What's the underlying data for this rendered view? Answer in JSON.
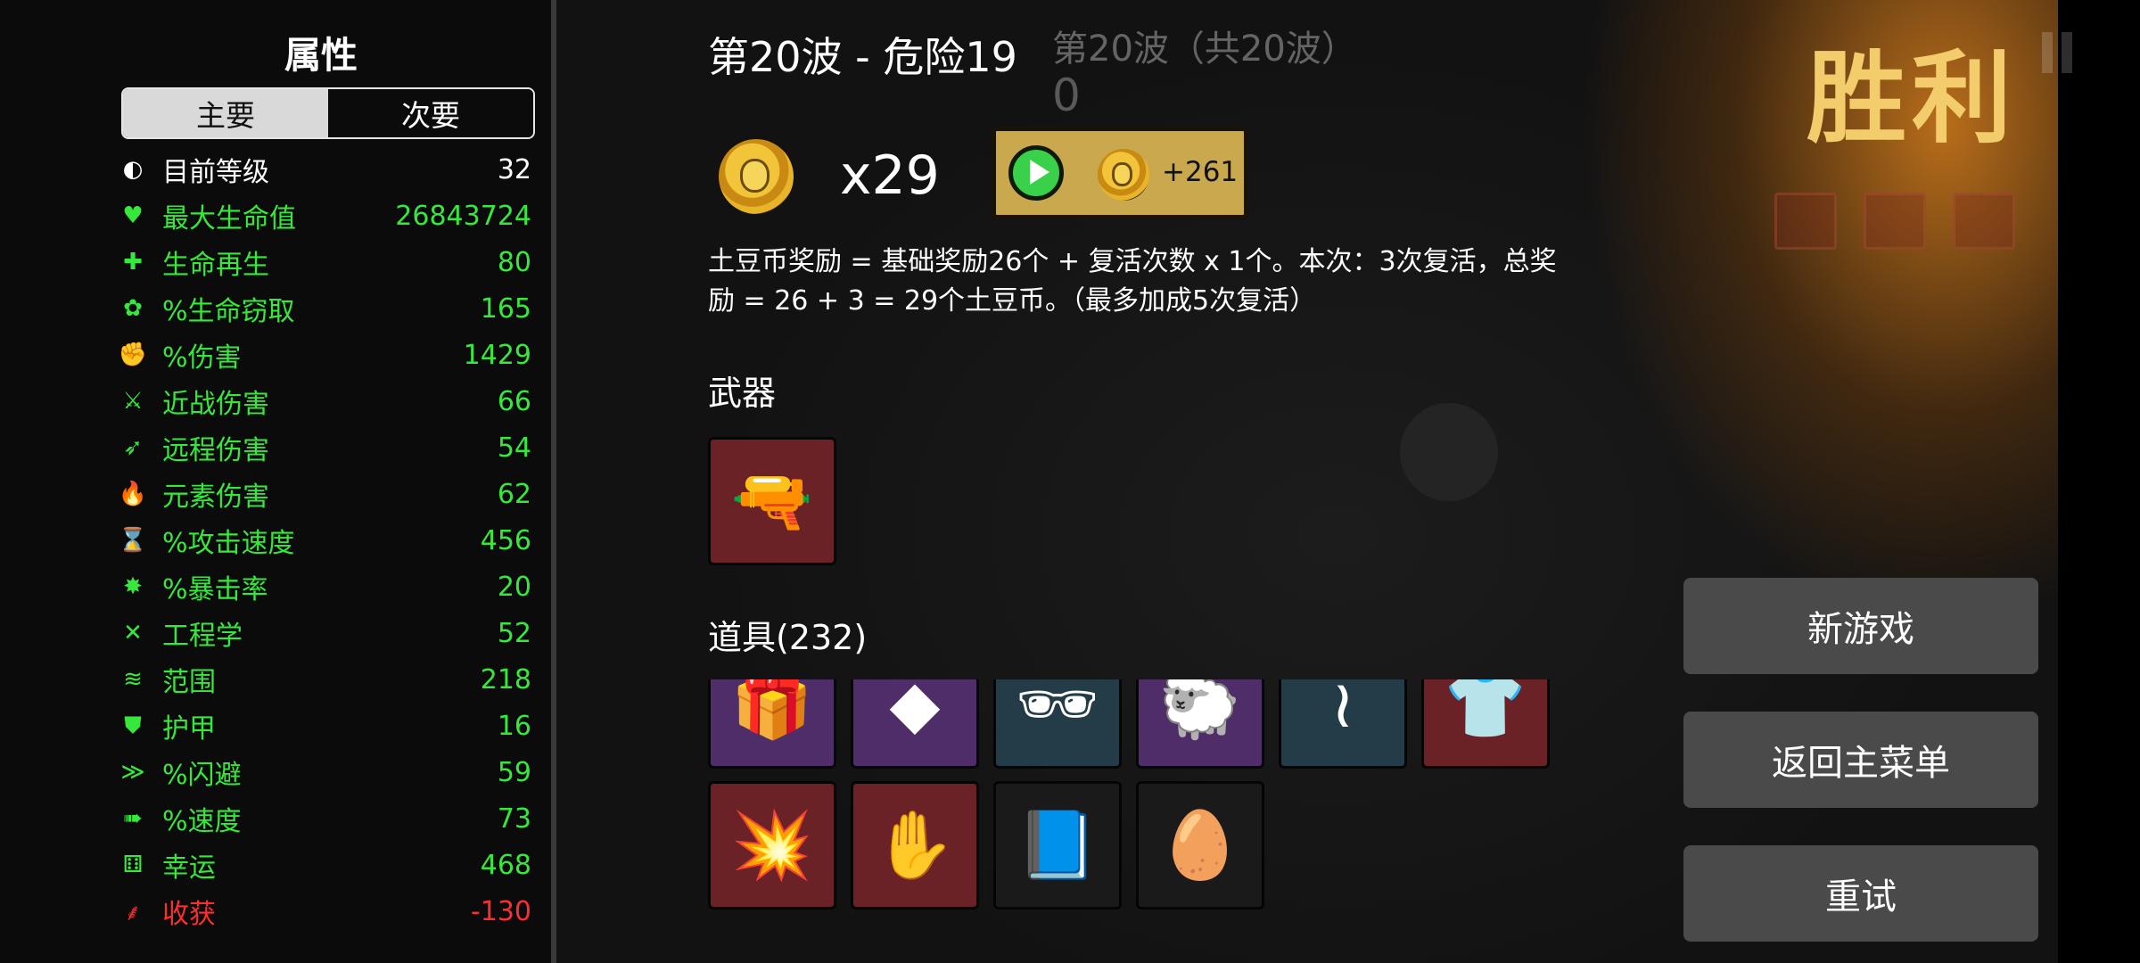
{
  "panel": {
    "title": "属性",
    "tabs": [
      {
        "label": "主要",
        "active": true
      },
      {
        "label": "次要",
        "active": false
      }
    ],
    "stats": [
      {
        "icon": "level-icon",
        "glyph": "◐",
        "label": "目前等级",
        "value": "32",
        "label_color": "#ffffff",
        "value_color": "#ffffff"
      },
      {
        "icon": "heart-icon",
        "glyph": "♥",
        "label": "最大生命值",
        "value": "26843724",
        "label_color": "#37e83c",
        "value_color": "#37e83c"
      },
      {
        "icon": "regen-icon",
        "glyph": "✚",
        "label": "生命再生",
        "value": "80",
        "label_color": "#37e83c",
        "value_color": "#37e83c"
      },
      {
        "icon": "lifesteal-icon",
        "glyph": "✿",
        "label": "%生命窃取",
        "value": "165",
        "label_color": "#37e83c",
        "value_color": "#37e83c"
      },
      {
        "icon": "damage-icon",
        "glyph": "✊",
        "label": "%伤害",
        "value": "1429",
        "label_color": "#37e83c",
        "value_color": "#37e83c"
      },
      {
        "icon": "melee-icon",
        "glyph": "⚔",
        "label": "近战伤害",
        "value": "66",
        "label_color": "#37e83c",
        "value_color": "#37e83c"
      },
      {
        "icon": "ranged-icon",
        "glyph": "➶",
        "label": "远程伤害",
        "value": "54",
        "label_color": "#37e83c",
        "value_color": "#37e83c"
      },
      {
        "icon": "elemental-icon",
        "glyph": "🔥",
        "label": "元素伤害",
        "value": "62",
        "label_color": "#37e83c",
        "value_color": "#37e83c"
      },
      {
        "icon": "hourglass-icon",
        "glyph": "⌛",
        "label": "%攻击速度",
        "value": "456",
        "label_color": "#37e83c",
        "value_color": "#37e83c"
      },
      {
        "icon": "crit-icon",
        "glyph": "✸",
        "label": "%暴击率",
        "value": "20",
        "label_color": "#37e83c",
        "value_color": "#37e83c"
      },
      {
        "icon": "engineering-icon",
        "glyph": "✕",
        "label": "工程学",
        "value": "52",
        "label_color": "#37e83c",
        "value_color": "#37e83c"
      },
      {
        "icon": "range-icon",
        "glyph": "≋",
        "label": "范围",
        "value": "218",
        "label_color": "#37e83c",
        "value_color": "#37e83c"
      },
      {
        "icon": "armor-icon",
        "glyph": "⛊",
        "label": "护甲",
        "value": "16",
        "label_color": "#37e83c",
        "value_color": "#37e83c"
      },
      {
        "icon": "dodge-icon",
        "glyph": "≫",
        "label": "%闪避",
        "value": "59",
        "label_color": "#37e83c",
        "value_color": "#37e83c"
      },
      {
        "icon": "speed-icon",
        "glyph": "➠",
        "label": "%速度",
        "value": "73",
        "label_color": "#37e83c",
        "value_color": "#37e83c"
      },
      {
        "icon": "luck-icon",
        "glyph": "⚅",
        "label": "幸运",
        "value": "468",
        "label_color": "#37e83c",
        "value_color": "#37e83c"
      },
      {
        "icon": "harvest-icon",
        "glyph": "⸙",
        "label": "收获",
        "value": "-130",
        "label_color": "#ff2e2e",
        "value_color": "#ff2e2e"
      }
    ]
  },
  "header": {
    "wave_title": "第20波 - 危险19",
    "ghost_wave": "第20波（共20波）",
    "ghost_zero": "0"
  },
  "reward": {
    "coin_count": "x29",
    "ad_bonus": "+261",
    "description": "土豆币奖励 = 基础奖励26个 + 复活次数 x 1个。本次：3次复活，总奖励 = 26 + 3 = 29个土豆币。（最多加成5次复活）"
  },
  "weapons": {
    "heading": "武器",
    "items": [
      {
        "icon": "blaster-icon",
        "glyph": "🔫",
        "bg": "red"
      }
    ]
  },
  "items": {
    "heading": "道具(232)",
    "row1": [
      {
        "icon": "gift-box-icon",
        "glyph": "🎁",
        "bg": "purple"
      },
      {
        "icon": "crystal-icon",
        "glyph": "◆",
        "bg": "purple"
      },
      {
        "icon": "sunglasses-icon",
        "glyph": "🕶",
        "bg": "teal"
      },
      {
        "icon": "sheep-icon",
        "glyph": "🐑",
        "bg": "purple"
      },
      {
        "icon": "hair-icon",
        "glyph": "≀",
        "bg": "teal"
      },
      {
        "icon": "hoodie-icon",
        "glyph": "👕",
        "bg": "red"
      }
    ],
    "row2": [
      {
        "icon": "bullet-icon",
        "glyph": "💥",
        "bg": "red"
      },
      {
        "icon": "claw-icon",
        "glyph": "✋",
        "bg": "red"
      },
      {
        "icon": "book-icon",
        "glyph": "📘",
        "bg": "dark"
      },
      {
        "icon": "egg-icon",
        "glyph": "🥚",
        "bg": "dark"
      }
    ]
  },
  "victory": "胜利",
  "buttons": {
    "new_game": "新游戏",
    "main_menu": "返回主菜单",
    "retry": "重试"
  }
}
